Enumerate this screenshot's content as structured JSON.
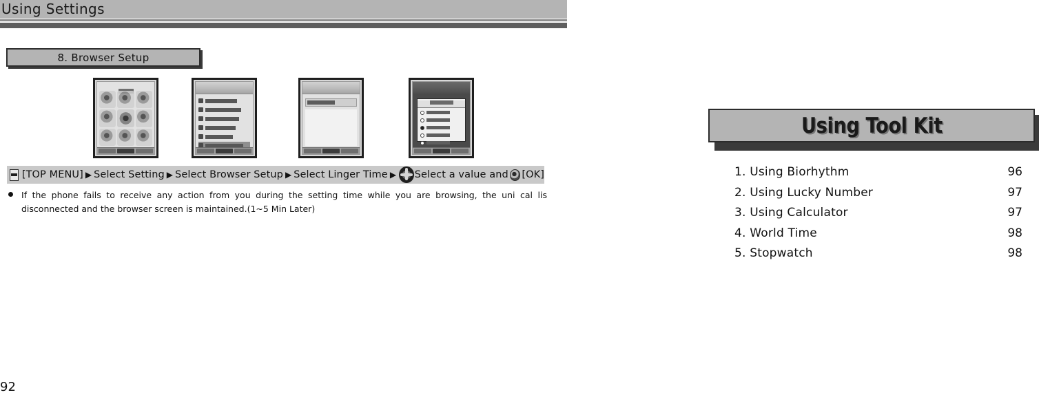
{
  "left_page": {
    "header": {
      "title": "Using Settings"
    },
    "section": {
      "heading": "8. Browser Setup"
    },
    "screens": [
      {
        "name": "main-menu-grid-screen",
        "kind": "icon-grid"
      },
      {
        "name": "settings-list-screen",
        "kind": "list"
      },
      {
        "name": "browser-setup-screen",
        "kind": "field"
      },
      {
        "name": "linger-time-dialog-screen",
        "kind": "dialog"
      }
    ],
    "step_bar": {
      "menu_icon": "menu-icon",
      "step1": "[TOP MENU]",
      "arrow1": "▶",
      "step2": "Select Setting",
      "arrow2": "▶",
      "step3": "Select Browser Setup",
      "arrow3": "▶",
      "step4": "Select Linger Time",
      "arrow4": "▶",
      "dpad_icon": "dpad-icon",
      "step5": "Select a value and",
      "ok_icon": "ok-button-icon",
      "step6": "[OK]"
    },
    "note": {
      "bullet": "●",
      "text": "If the phone fails to receive any action from you during the setting time while you are browsing, the uni cal lis disconnected and the browser screen is maintained.(1~5 Min Later)"
    },
    "page_number": "92"
  },
  "right_page": {
    "title": "Using Tool Kit",
    "toc": [
      {
        "label": "1. Using Biorhythm",
        "page": "96"
      },
      {
        "label": "2. Using Lucky Number",
        "page": "97"
      },
      {
        "label": "3. Using Calculator",
        "page": "97"
      },
      {
        "label": "4. World Time",
        "page": "98"
      },
      {
        "label": "5. Stopwatch",
        "page": "98"
      }
    ]
  },
  "colors": {
    "header_gray": "#b4b4b4",
    "header_dark_bar": "#5e5e5e",
    "plate_gray": "#b4b4b4",
    "plate_border": "#2b2b2b",
    "shadow": "#3a3a3a",
    "step_bar_gray": "#c9c9c9",
    "text": "#111111"
  }
}
